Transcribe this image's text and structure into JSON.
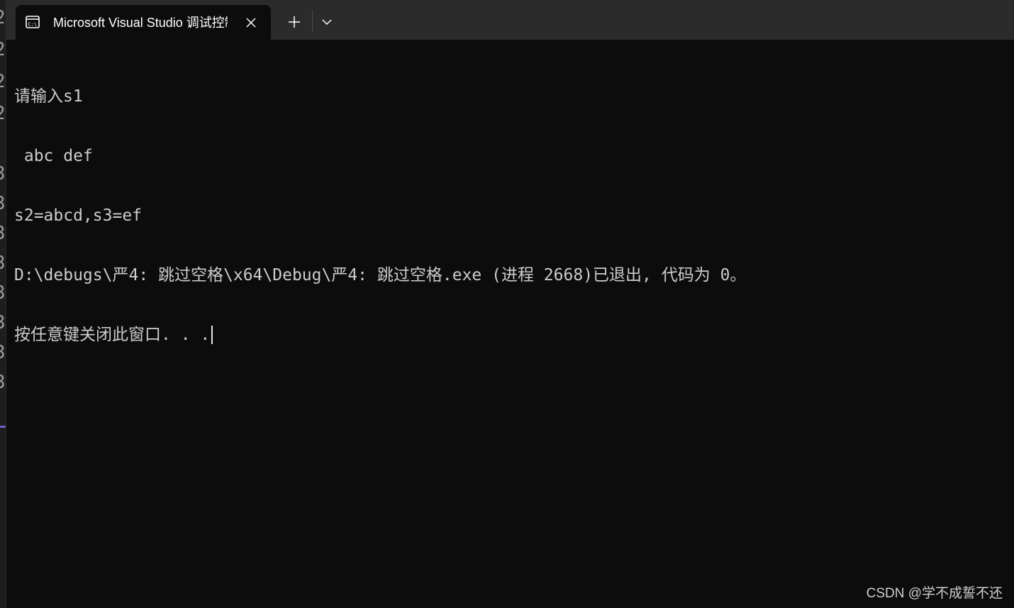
{
  "tab": {
    "title": "Microsoft Visual Studio 调试控制台",
    "icon": "console-icon"
  },
  "toolbar": {
    "close_icon": "close-icon",
    "new_tab_icon": "plus-icon",
    "dropdown_icon": "chevron-down-icon"
  },
  "console": {
    "lines": [
      "请输入s1",
      " abc def",
      "s2=abcd,s3=ef",
      "D:\\debugs\\严4: 跳过空格\\x64\\Debug\\严4: 跳过空格.exe (进程 2668)已退出, 代码为 0。",
      "按任意键关闭此窗口. . ."
    ]
  },
  "watermark": "CSDN @学不成誓不还",
  "colors": {
    "background": "#0c0c0c",
    "titlebar": "#2b2b2b",
    "text": "#cccccc",
    "tab_text": "#ffffff"
  }
}
